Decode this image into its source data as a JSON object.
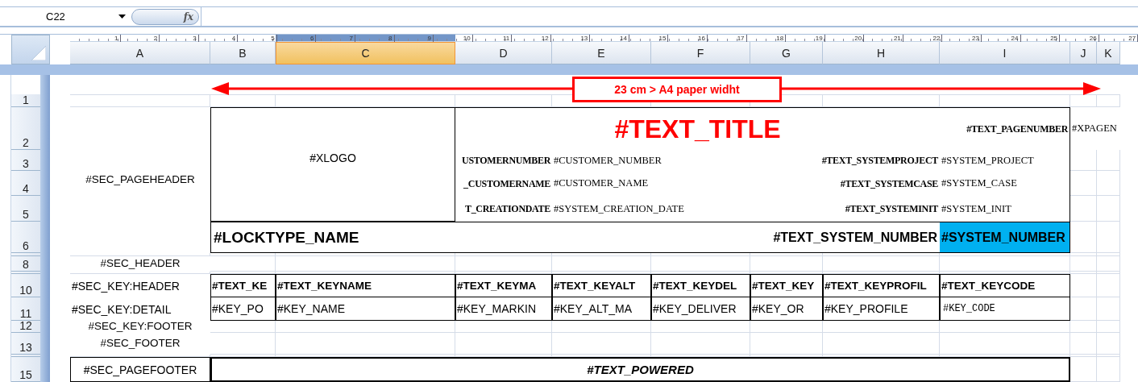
{
  "name_box": {
    "value": "C22"
  },
  "function_button": {
    "label": "fx"
  },
  "ruler": [
    "1",
    "2",
    "3",
    "4",
    "5",
    "6",
    "7",
    "8",
    "9",
    "10",
    "11",
    "12",
    "13",
    "14",
    "15",
    "16",
    "17",
    "18",
    "19",
    "20",
    "21",
    "22",
    "23",
    "24",
    "25",
    "26",
    "27"
  ],
  "columns": [
    {
      "label": "A",
      "selected": false
    },
    {
      "label": "B",
      "selected": false
    },
    {
      "label": "C",
      "selected": true
    },
    {
      "label": "D",
      "selected": false
    },
    {
      "label": "E",
      "selected": false
    },
    {
      "label": "F",
      "selected": false
    },
    {
      "label": "G",
      "selected": false
    },
    {
      "label": "H",
      "selected": false
    },
    {
      "label": "I",
      "selected": false
    },
    {
      "label": "J",
      "selected": false
    },
    {
      "label": "K",
      "selected": false
    }
  ],
  "rows": [
    "1",
    "2",
    "3",
    "4",
    "5",
    "6",
    "8",
    "10",
    "11",
    "12",
    "13",
    "15"
  ],
  "annotation": {
    "text": "23 cm > A4 paper widht"
  },
  "cells": [
    {
      "kind": "section",
      "text": "#SEC_PAGEHEADER"
    },
    {
      "kind": "logo_placeholder",
      "text": "#XLOGO"
    },
    {
      "kind": "title",
      "text": "#TEXT_TITLE"
    },
    {
      "kind": "field_label",
      "text": "#TEXT_PAGENUMBER"
    },
    {
      "kind": "field_value",
      "text": "#XPAGEN"
    },
    {
      "kind": "field_label",
      "text": "USTOMERNUMBER"
    },
    {
      "kind": "field_value",
      "text": "#CUSTOMER_NUMBER"
    },
    {
      "kind": "field_label",
      "text": "#TEXT_SYSTEMPROJECT"
    },
    {
      "kind": "field_value",
      "text": "#SYSTEM_PROJECT"
    },
    {
      "kind": "field_label",
      "text": "_CUSTOMERNAME"
    },
    {
      "kind": "field_value",
      "text": "#CUSTOMER_NAME"
    },
    {
      "kind": "field_label",
      "text": "#TEXT_SYSTEMCASE"
    },
    {
      "kind": "field_value",
      "text": "#SYSTEM_CASE"
    },
    {
      "kind": "field_label",
      "text": "T_CREATIONDATE"
    },
    {
      "kind": "field_value",
      "text": "#SYSTEM_CREATION_DATE"
    },
    {
      "kind": "field_label",
      "text": "#TEXT_SYSTEMINIT"
    },
    {
      "kind": "field_value",
      "text": "#SYSTEM_INIT"
    },
    {
      "kind": "caption",
      "text": "#LOCKTYPE_NAME"
    },
    {
      "kind": "caption_right",
      "text": "#TEXT_SYSTEM_NUMBER"
    },
    {
      "kind": "highlight",
      "text": "#SYSTEM_NUMBER"
    },
    {
      "kind": "section",
      "text": "#SEC_HEADER"
    },
    {
      "kind": "section_left",
      "text": "#SEC_KEY:HEADER"
    },
    {
      "kind": "column_heading",
      "text": "#TEXT_KE"
    },
    {
      "kind": "column_heading",
      "text": "#TEXT_KEYNAME"
    },
    {
      "kind": "column_heading",
      "text": "#TEXT_KEYMA"
    },
    {
      "kind": "column_heading",
      "text": "#TEXT_KEYALT"
    },
    {
      "kind": "column_heading",
      "text": "#TEXT_KEYDEL"
    },
    {
      "kind": "column_heading",
      "text": "#TEXT_KEY"
    },
    {
      "kind": "column_heading",
      "text": "#TEXT_KEYPROFIL"
    },
    {
      "kind": "column_heading",
      "text": "#TEXT_KEYCODE"
    },
    {
      "kind": "section_left",
      "text": "#SEC_KEY:DETAIL"
    },
    {
      "kind": "detail",
      "text": "#KEY_PO"
    },
    {
      "kind": "detail",
      "text": "#KEY_NAME"
    },
    {
      "kind": "detail",
      "text": "#KEY_MARKIN"
    },
    {
      "kind": "detail",
      "text": "#KEY_ALT_MA"
    },
    {
      "kind": "detail",
      "text": "#KEY_DELIVER"
    },
    {
      "kind": "detail",
      "text": "#KEY_OR"
    },
    {
      "kind": "detail",
      "text": "#KEY_PROFILE"
    },
    {
      "kind": "detail_mono",
      "text": "#KEY_CODE"
    },
    {
      "kind": "section",
      "text": "#SEC_KEY:FOOTER"
    },
    {
      "kind": "section",
      "text": "#SEC_FOOTER"
    },
    {
      "kind": "section_boxed",
      "text": "#SEC_PAGEFOOTER"
    },
    {
      "kind": "footer",
      "text": "#TEXT_POWERED"
    }
  ]
}
